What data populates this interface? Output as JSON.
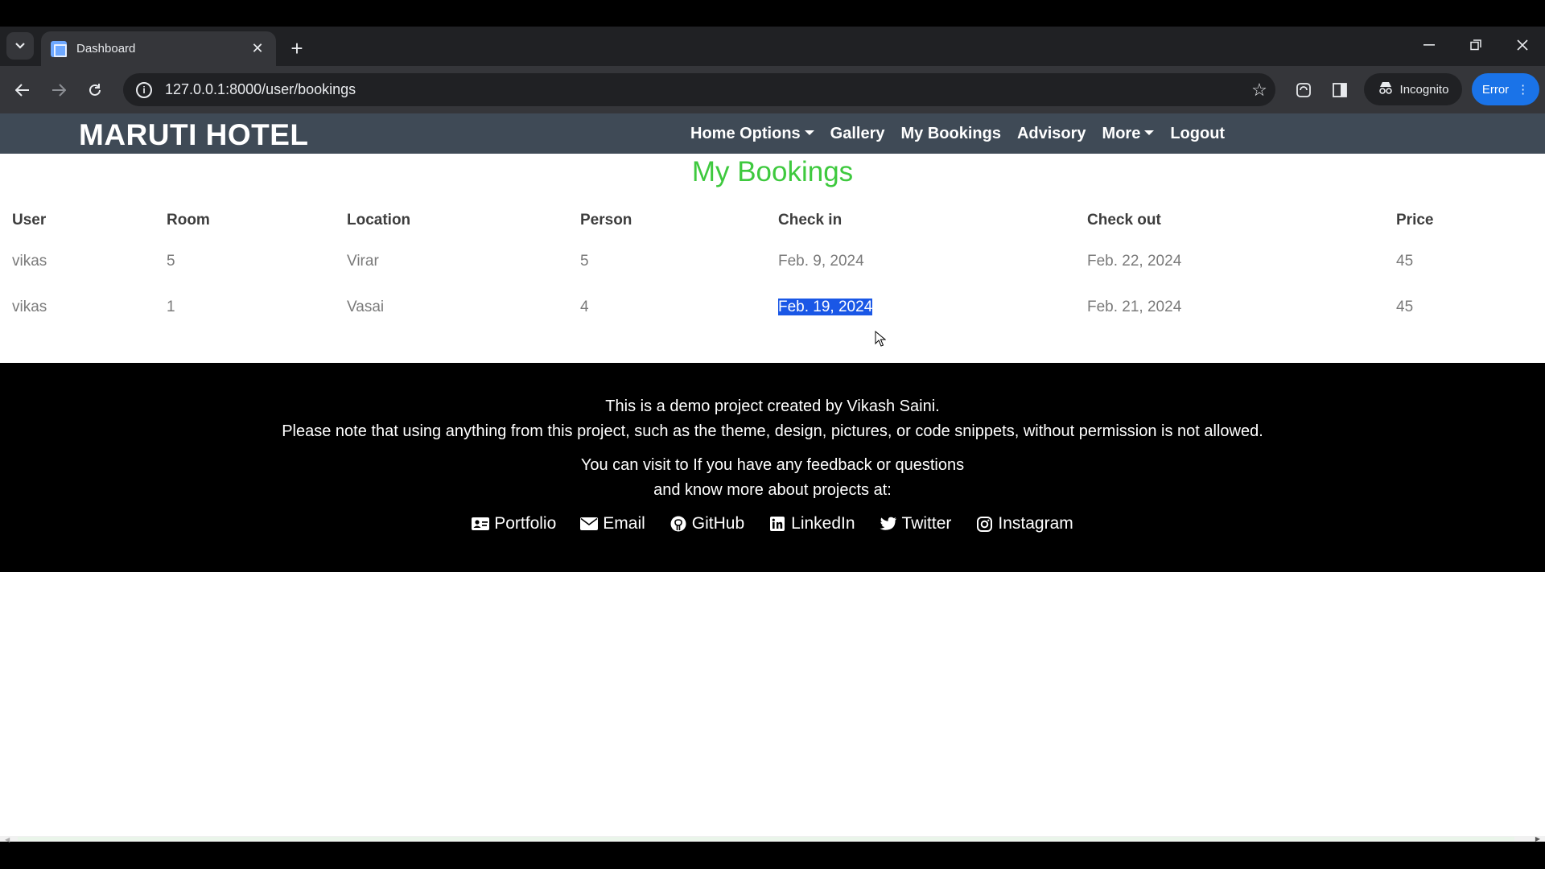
{
  "browser": {
    "tab_title": "Dashboard",
    "url": "127.0.0.1:8000/user/bookings",
    "incognito_label": "Incognito",
    "error_label": "Error"
  },
  "site": {
    "brand": "MARUTI HOTEL",
    "nav": {
      "home_options": "Home Options",
      "gallery": "Gallery",
      "my_bookings": "My Bookings",
      "advisory": "Advisory",
      "more": "More",
      "logout": "Logout"
    }
  },
  "main": {
    "heading": "My Bookings",
    "columns": [
      "User",
      "Room",
      "Location",
      "Person",
      "Check in",
      "Check out",
      "Price"
    ],
    "rows": [
      [
        "vikas",
        "5",
        "Virar",
        "5",
        "Feb. 9, 2024",
        "Feb. 22, 2024",
        "45"
      ],
      [
        "vikas",
        "1",
        "Vasai",
        "4",
        "Feb. 19, 2024",
        "Feb. 21, 2024",
        "45"
      ]
    ],
    "selected_cell_text": "Feb. 19, 2024"
  },
  "footer": {
    "line1": "This is a demo project created by Vikash Saini.",
    "line2": "Please note that using anything from this project, such as the theme, design, pictures, or code snippets, without permission is not allowed.",
    "line3": "You can visit to If you have any feedback or questions",
    "line4": "and know more about projects at:",
    "links": {
      "portfolio": "Portfolio",
      "email": "Email",
      "github": "GitHub",
      "linkedin": "LinkedIn",
      "twitter": "Twitter",
      "instagram": "Instagram"
    }
  },
  "colors": {
    "navbar_bg": "#3f4a56",
    "heading_green": "#3ec93e",
    "selection_blue": "#1a57e6",
    "footer_bg": "#000000"
  }
}
